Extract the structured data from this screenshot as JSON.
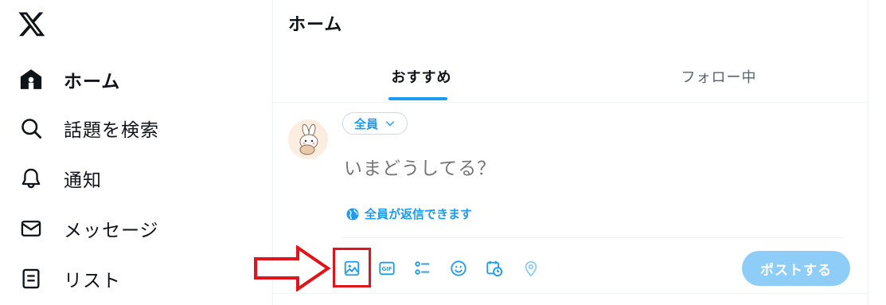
{
  "sidebar": {
    "logo_icon": "x-logo",
    "items": [
      {
        "label": "ホーム",
        "icon": "home-icon",
        "active": true
      },
      {
        "label": "話題を検索",
        "icon": "search-icon"
      },
      {
        "label": "通知",
        "icon": "bell-icon"
      },
      {
        "label": "メッセージ",
        "icon": "mail-icon"
      },
      {
        "label": "リスト",
        "icon": "list-icon"
      }
    ]
  },
  "header": {
    "title": "ホーム",
    "tabs": [
      {
        "label": "おすすめ",
        "active": true
      },
      {
        "label": "フォロー中",
        "active": false
      }
    ]
  },
  "composer": {
    "audience_label": "全員",
    "placeholder": "いまどうしてる？",
    "reply_setting_label": "全員が返信できます",
    "tools": [
      "image-icon",
      "gif-icon",
      "poll-icon",
      "emoji-icon",
      "schedule-icon",
      "location-icon"
    ],
    "gif_text": "GIF",
    "post_button_label": "ポストする"
  },
  "colors": {
    "accent": "#1d9bf0",
    "post_button_disabled": "#8ecdf8",
    "annotation_red": "#e3131a",
    "text_primary": "#0f1419",
    "text_secondary": "#536471"
  }
}
